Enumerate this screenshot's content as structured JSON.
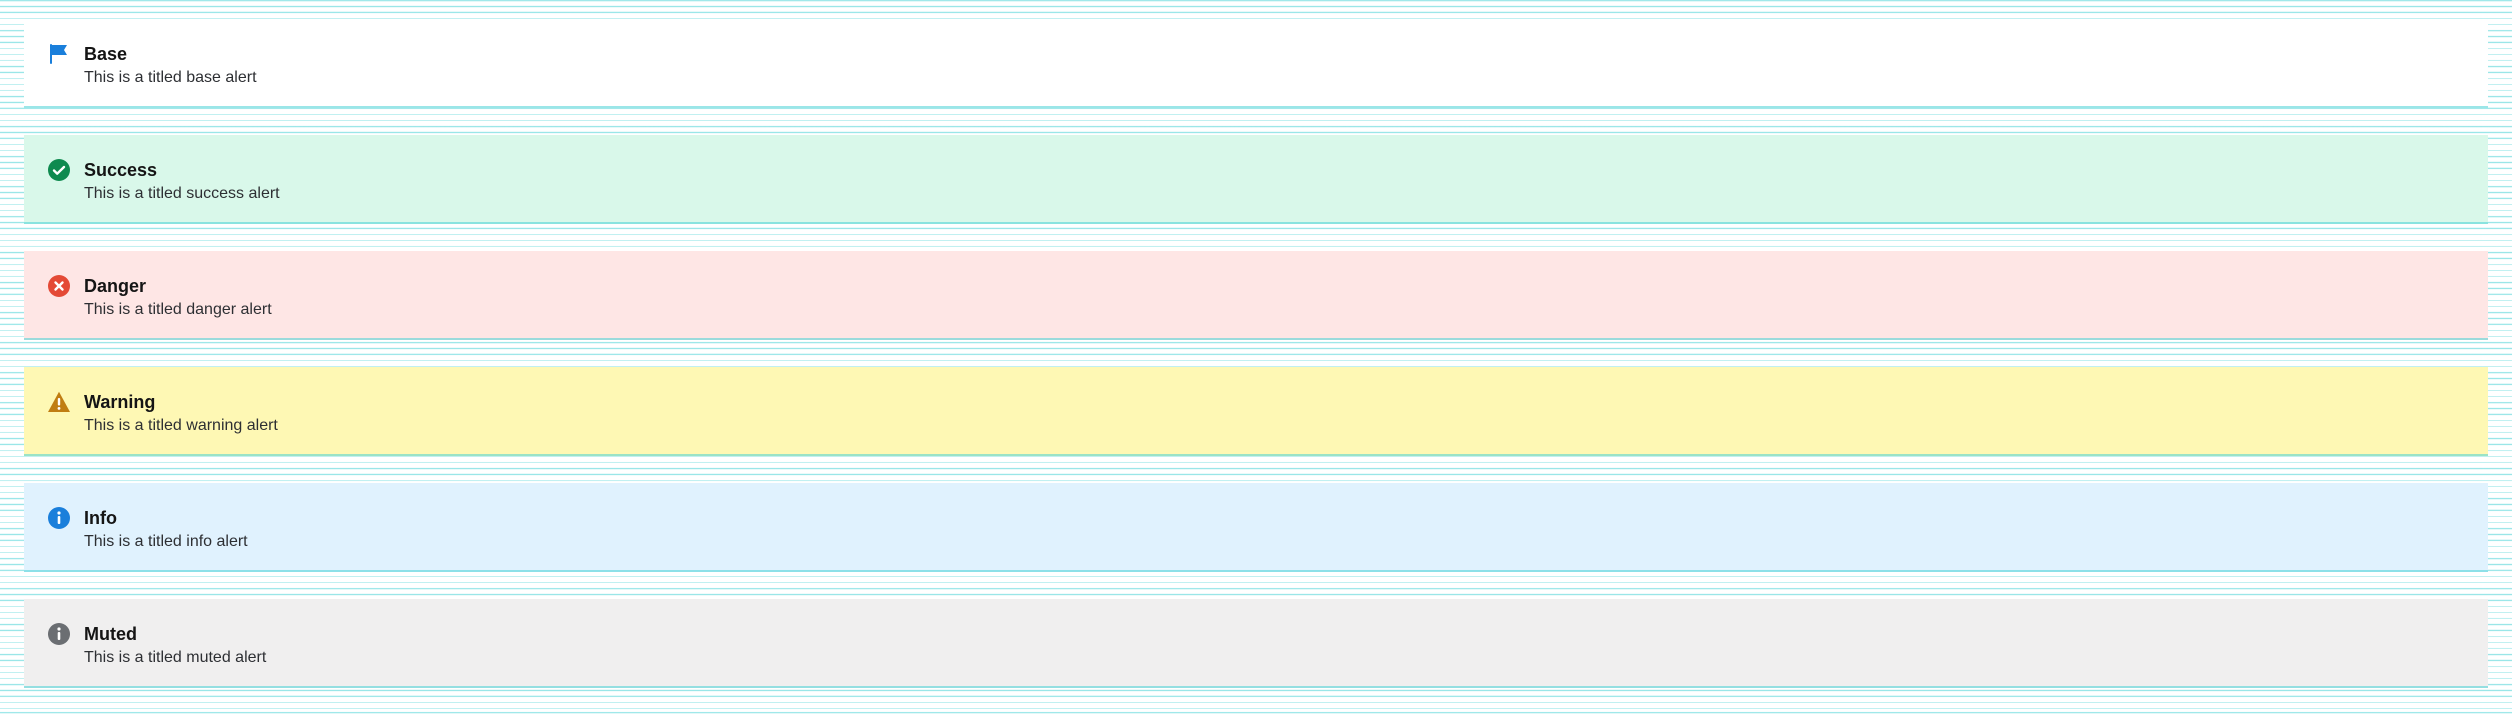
{
  "alerts": [
    {
      "variant": "base",
      "icon": "flag-icon",
      "title": "Base",
      "message": "This is a titled base alert",
      "background": "#ffffff",
      "icon_color": "#1a7fdb"
    },
    {
      "variant": "success",
      "icon": "check-circle-icon",
      "title": "Success",
      "message": "This is a titled success alert",
      "background": "#d9f8ea",
      "icon_color": "#0e8a4f"
    },
    {
      "variant": "danger",
      "icon": "x-circle-icon",
      "title": "Danger",
      "message": "This is a titled danger alert",
      "background": "#fee6e5",
      "icon_color": "#e44a36"
    },
    {
      "variant": "warning",
      "icon": "warning-triangle-icon",
      "title": "Warning",
      "message": "This is a titled warning alert",
      "background": "#fef8b4",
      "icon_color": "#c07d11"
    },
    {
      "variant": "info",
      "icon": "info-circle-icon",
      "title": "Info",
      "message": "This is a titled info alert",
      "background": "#e0f2fe",
      "icon_color": "#1a7fdb"
    },
    {
      "variant": "muted",
      "icon": "info-circle-icon",
      "title": "Muted",
      "message": "This is a titled muted alert",
      "background": "#f0efef",
      "icon_color": "#6b6e72"
    }
  ]
}
